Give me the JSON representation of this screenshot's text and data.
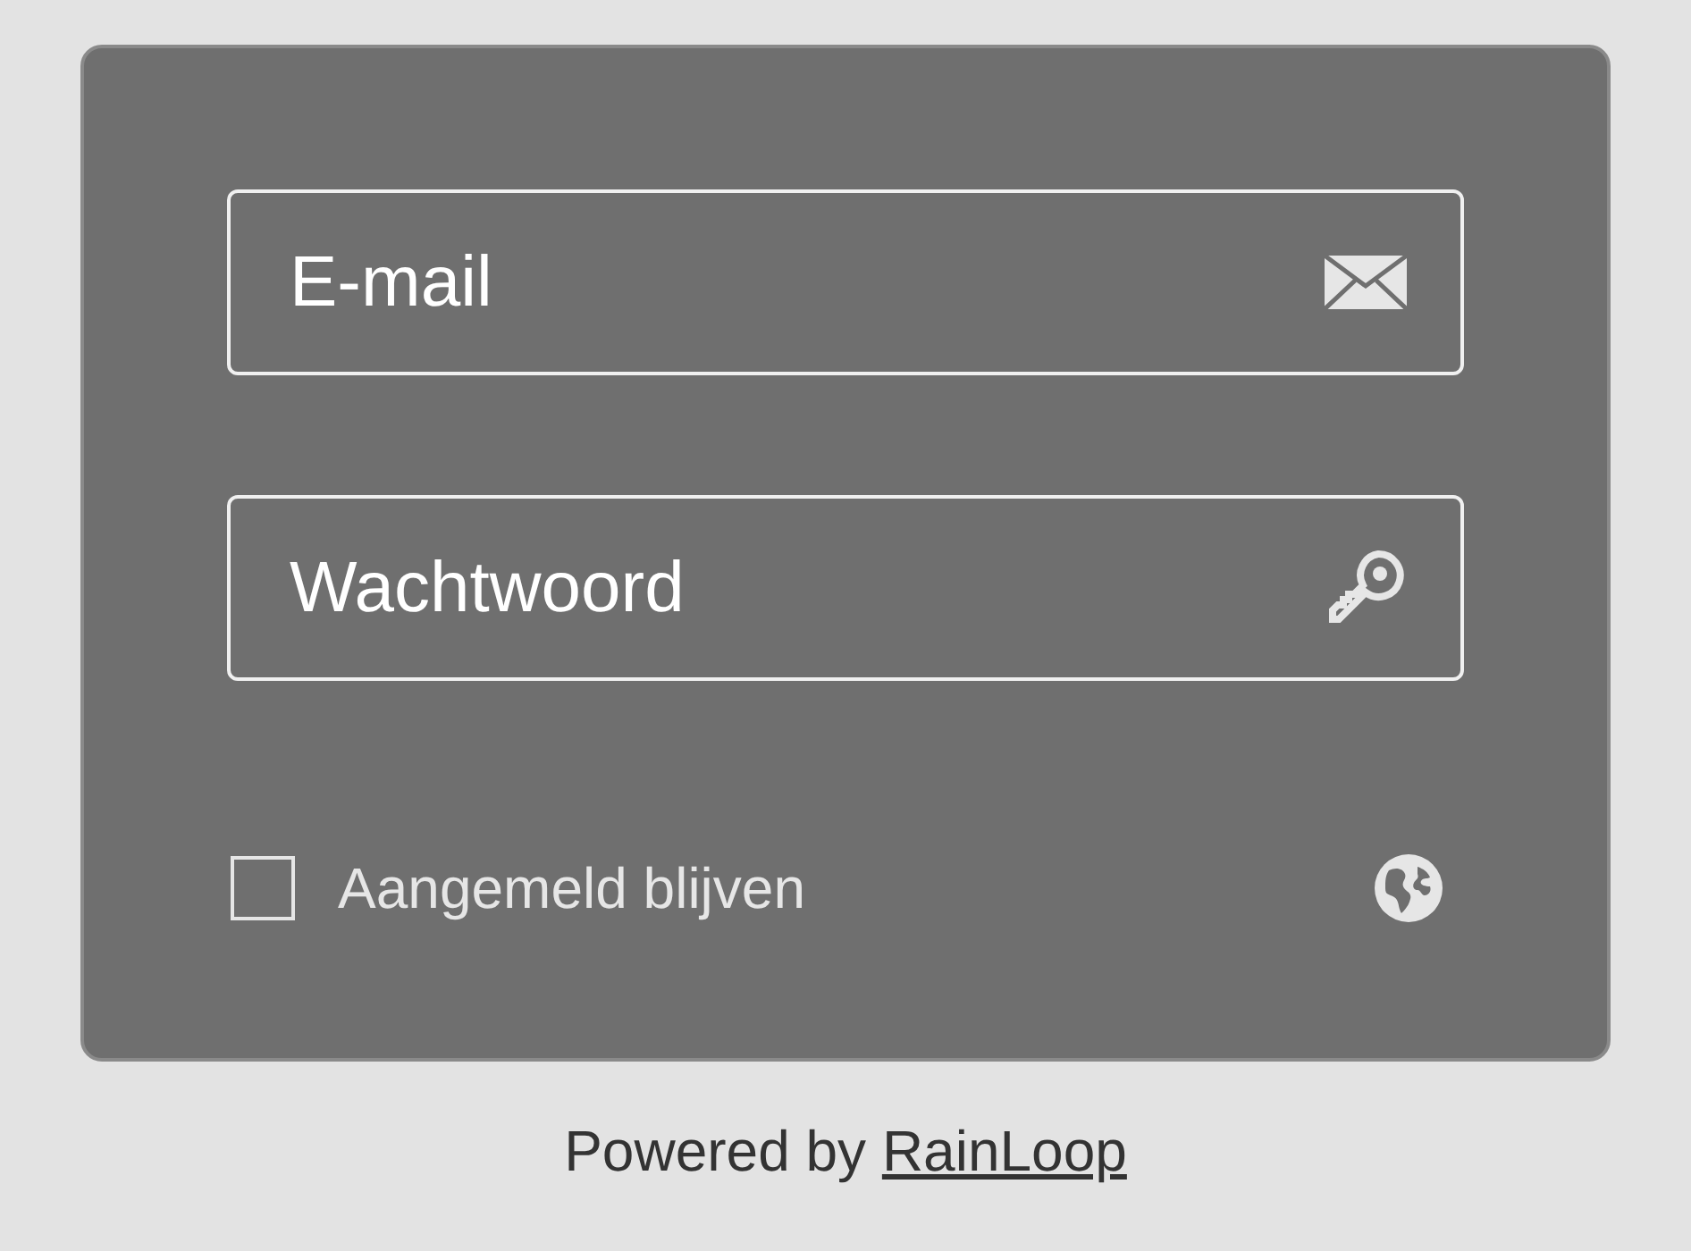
{
  "login_form": {
    "fields": [
      {
        "kind": "email",
        "placeholder": "E-mail"
      },
      {
        "kind": "password",
        "placeholder": "Wachtwoord"
      }
    ],
    "remember_me": {
      "label": "Aangemeld blijven",
      "checked": false
    }
  },
  "footer": {
    "text": "Powered by",
    "link": "RainLoop"
  }
}
